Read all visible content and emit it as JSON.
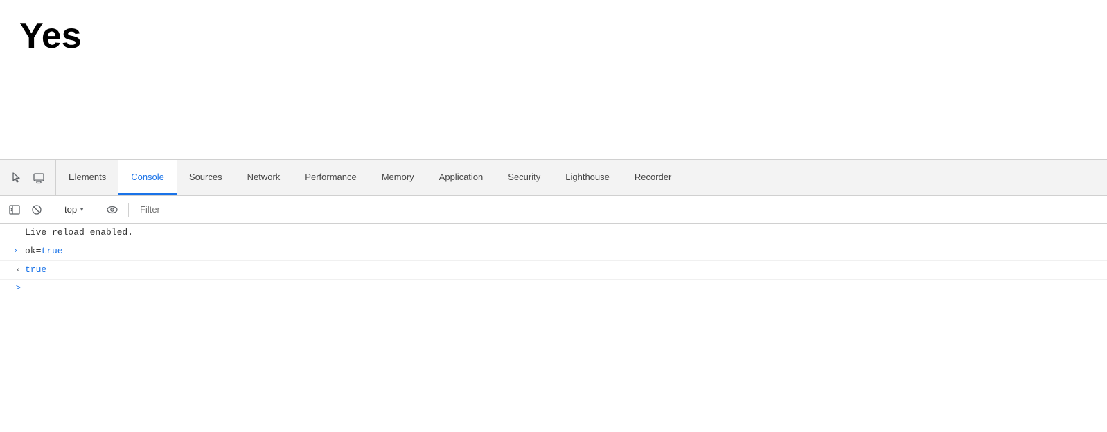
{
  "page": {
    "title": "Yes"
  },
  "devtools": {
    "tab_icons": [
      {
        "name": "cursor-icon",
        "symbol": "⬡",
        "label": "Inspect element"
      },
      {
        "name": "device-icon",
        "symbol": "▭",
        "label": "Toggle device toolbar"
      }
    ],
    "tabs": [
      {
        "id": "elements",
        "label": "Elements",
        "active": false
      },
      {
        "id": "console",
        "label": "Console",
        "active": true
      },
      {
        "id": "sources",
        "label": "Sources",
        "active": false
      },
      {
        "id": "network",
        "label": "Network",
        "active": false
      },
      {
        "id": "performance",
        "label": "Performance",
        "active": false
      },
      {
        "id": "memory",
        "label": "Memory",
        "active": false
      },
      {
        "id": "application",
        "label": "Application",
        "active": false
      },
      {
        "id": "security",
        "label": "Security",
        "active": false
      },
      {
        "id": "lighthouse",
        "label": "Lighthouse",
        "active": false
      },
      {
        "id": "recorder",
        "label": "Recorder",
        "active": false
      }
    ],
    "console_toolbar": {
      "top_label": "top",
      "filter_placeholder": "Filter"
    },
    "console_output": [
      {
        "id": "live-reload",
        "type": "plain",
        "gutter": "",
        "text": "Live reload enabled.",
        "arrow": ""
      },
      {
        "id": "ok-true",
        "type": "value",
        "gutter": ">",
        "text": "ok=true",
        "arrow": "›"
      },
      {
        "id": "true-value",
        "type": "return",
        "gutter": "<",
        "text": "true",
        "arrow": "‹"
      }
    ],
    "prompt": {
      "gutter": ">"
    }
  },
  "colors": {
    "accent": "#1a73e8",
    "active_tab_border": "#1a73e8",
    "console_blue": "#1a1aa6",
    "console_value": "#1a73e8"
  }
}
